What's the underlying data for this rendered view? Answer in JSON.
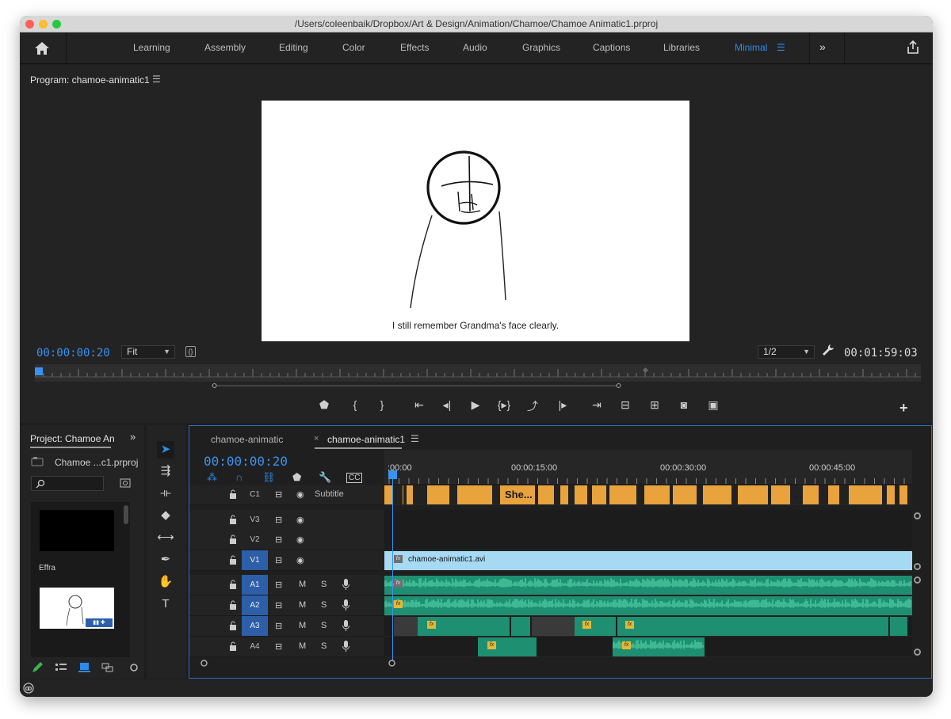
{
  "window": {
    "title": "/Users/coleenbaik/Dropbox/Art & Design/Animation/Chamoe/Chamoe Animatic1.prproj"
  },
  "workspaces": [
    "Learning",
    "Assembly",
    "Editing",
    "Color",
    "Effects",
    "Audio",
    "Graphics",
    "Captions",
    "Libraries",
    "Minimal"
  ],
  "active_workspace": "Minimal",
  "program": {
    "title": "Program: chamoe-animatic1",
    "subtitle_text": "I still remember Grandma's face clearly.",
    "current_timecode": "00:00:00:20",
    "zoom": "Fit",
    "resolution": "1/2",
    "duration": "00:01:59:03"
  },
  "project": {
    "title": "Project: Chamoe An",
    "file": "Chamoe ...c1.prproj",
    "bin_items": [
      {
        "label": "Effra",
        "type": "black"
      },
      {
        "label": "",
        "type": "sketch"
      }
    ]
  },
  "timeline": {
    "tabs": [
      {
        "label": "chamoe-animatic",
        "active": false
      },
      {
        "label": "chamoe-animatic1",
        "active": true
      }
    ],
    "timecode": "00:00:00:20",
    "ruler_labels": [
      ":00:00",
      "00:00:15:00",
      "00:00:30:00",
      "00:00:45:00"
    ],
    "tracks": [
      {
        "name": "C1",
        "type": "caption",
        "label": "Subtitle",
        "on": false
      },
      {
        "name": "V3",
        "type": "video",
        "on": false
      },
      {
        "name": "V2",
        "type": "video",
        "on": false
      },
      {
        "name": "V1",
        "type": "video",
        "on": true
      },
      {
        "name": "A1",
        "type": "audio",
        "on": true
      },
      {
        "name": "A2",
        "type": "audio",
        "on": true
      },
      {
        "name": "A3",
        "type": "audio",
        "on": true
      },
      {
        "name": "A4",
        "type": "audio",
        "on": false
      }
    ],
    "audio_labels": {
      "mute": "M",
      "solo": "S"
    },
    "subtitle_clips": [
      "She...",
      "..."
    ],
    "video_clip": "chamoe-animatic1.avi",
    "fx_label": "fx"
  },
  "colors": {
    "accent": "#2d8ceb",
    "subtitle_track": "#e8a33d",
    "video_clip": "#a6d9f2",
    "audio_clip": "#1f8f71",
    "track_on": "#2c5fa8"
  }
}
